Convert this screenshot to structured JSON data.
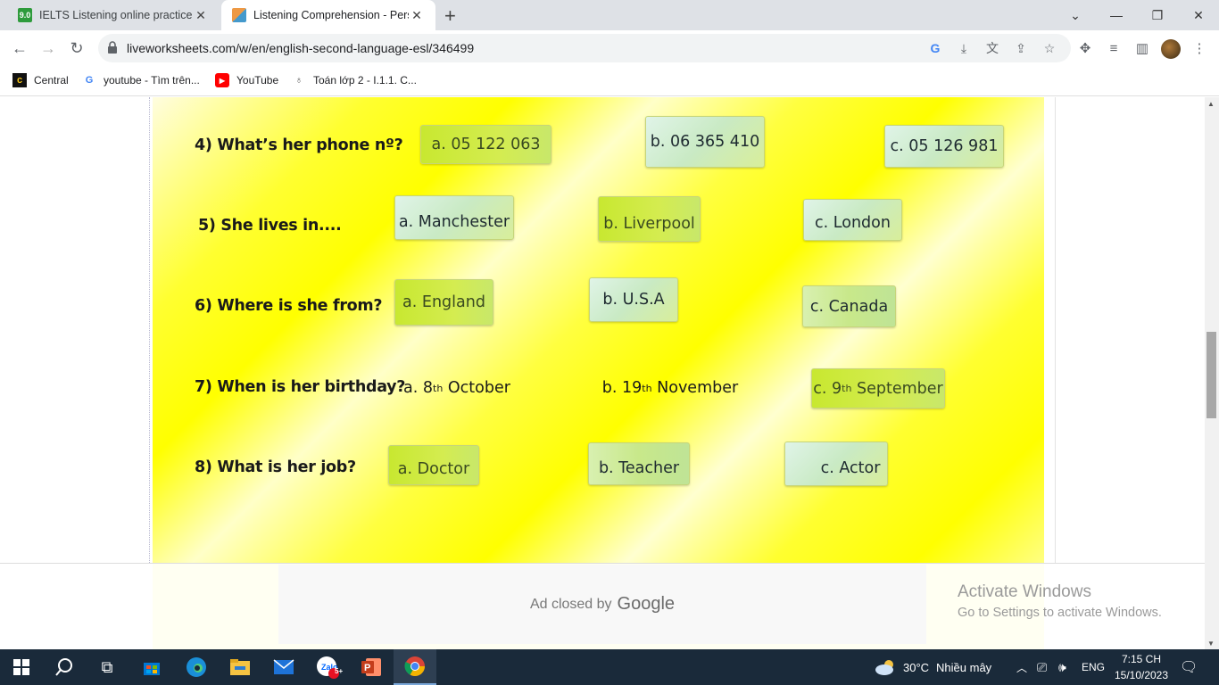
{
  "browser": {
    "tabs": [
      {
        "title": "IELTS Listening online practice. S",
        "favicon": "9.0",
        "active": false
      },
      {
        "title": "Listening Comprehension - Pers",
        "favicon": "LW",
        "active": true
      }
    ],
    "url": "liveworksheets.com/w/en/english-second-language-esl/346499",
    "bookmarks": [
      "Central",
      "youtube - Tìm trên...",
      "YouTube",
      "Toán lớp 2 - I.1.1. C..."
    ]
  },
  "worksheet": {
    "questions": [
      {
        "label": "4) What’s her phone nº?",
        "options": [
          "a. 05 122 063",
          "b. 06 365 410",
          "c. 05 126 981"
        ]
      },
      {
        "label": "5) She lives in....",
        "options": [
          "a. Manchester",
          "b. Liverpool",
          "c. London"
        ]
      },
      {
        "label": "6) Where is she from?",
        "options": [
          "a. England",
          "b. U.S.A",
          "c. Canada"
        ]
      },
      {
        "label": "7) When is her birthday?",
        "options": [
          {
            "pre": "a. 8",
            "sup": "th",
            "post": " October"
          },
          {
            "pre": "b. 19",
            "sup": "th",
            "post": " November"
          },
          {
            "pre": "c. 9",
            "sup": "th",
            "post": " September"
          }
        ]
      },
      {
        "label": "8) What is her job?",
        "options": [
          "a. Doctor",
          "b. Teacher",
          "c. Actor"
        ]
      }
    ]
  },
  "ad": {
    "text": "Ad closed by",
    "brand": "Google"
  },
  "watermark": {
    "title": "Activate Windows",
    "subtitle": "Go to Settings to activate Windows."
  },
  "taskbar": {
    "weather_temp": "30°C",
    "weather_text": "Nhiều mây",
    "lang": "ENG",
    "time": "7:15 CH",
    "date": "15/10/2023",
    "zalo_badge": "5+"
  }
}
